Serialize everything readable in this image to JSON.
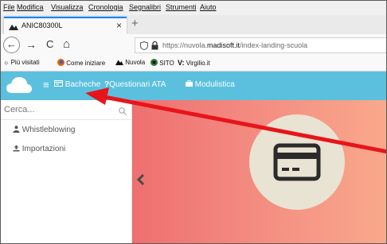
{
  "menu": [
    "File",
    "Modifica",
    "Visualizza",
    "Cronologia",
    "Segnalibri",
    "Strumenti",
    "Aiuto"
  ],
  "tab": {
    "title": "ANIC80300L",
    "close": "×",
    "new_tab": "+"
  },
  "nav": {
    "back": "←",
    "forward": "→",
    "reload": "C",
    "home": "⌂",
    "url_prefix": "https://nuvola.",
    "url_domain": "madisoft.it",
    "url_path": "/index-landing-scuola"
  },
  "bookmarks": [
    "Più visitati",
    "Come iniziare",
    "Nuvola",
    "SITO",
    "Virgilio.it"
  ],
  "header": {
    "menu_icon": "≡",
    "bacheche": "Bacheche",
    "questionari": "Questionari ATA",
    "modulistica": "Modulistica"
  },
  "sidebar": {
    "search_placeholder": "Cerca...",
    "items": [
      {
        "label": "Whistleblowing",
        "icon": "users-icon"
      },
      {
        "label": "Importazioni",
        "icon": "upload-icon"
      }
    ]
  },
  "main": {
    "prev": "‹",
    "icon": "credit-card-icon"
  },
  "colors": {
    "header": "#5bc0de",
    "gradient_start": "#ee6f6f",
    "gradient_end": "#f9a98c",
    "circle": "#e9e3d3",
    "arrow": "#e8141b"
  }
}
